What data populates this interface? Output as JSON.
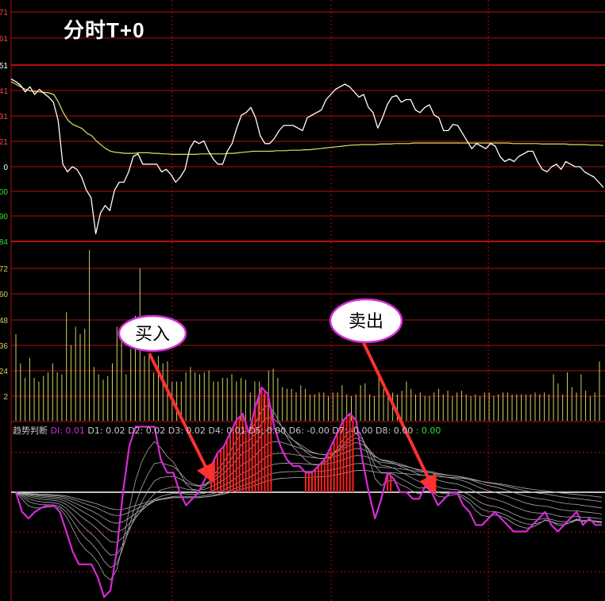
{
  "title": "分时T+0",
  "legend": {
    "name": "趋势判断",
    "items": [
      {
        "label": "DI: 0.01",
        "kind": "hl"
      },
      {
        "label": "D1: 0.02",
        "kind": ""
      },
      {
        "label": "D2: 0.02",
        "kind": ""
      },
      {
        "label": "D3: 0.02",
        "kind": ""
      },
      {
        "label": "D4: 0.01",
        "kind": ""
      },
      {
        "label": "D5: 0.00",
        "kind": ""
      },
      {
        "label": "D6: -0.00",
        "kind": ""
      },
      {
        "label": "D7: -0.00",
        "kind": ""
      },
      {
        "label": "D8: 0.00",
        "kind": ""
      },
      {
        "label": ": 0.00",
        "kind": "gr"
      }
    ]
  },
  "annotations": {
    "buy": "买入",
    "sell": "卖出"
  },
  "colors": {
    "background": "#000000",
    "grid": "#b01010",
    "price": "#ffffff",
    "average": "#e0e060",
    "volume": "#d0d060",
    "di": "#d52bd6",
    "d_lines": "#aaaaaa",
    "bars": "#ff2020",
    "arrow": "#ff3030",
    "ellipse": "#d52bd6"
  },
  "chart_data": [
    {
      "type": "line",
      "panel": "price",
      "y_tick_labels": [
        "71",
        "61",
        "51",
        "41",
        "31",
        "21",
        "0",
        "00",
        "90",
        "84"
      ],
      "series": [
        {
          "values": [
            1.7,
            1.65,
            1.58,
            1.45,
            1.55,
            1.4,
            1.5,
            1.42,
            1.35,
            1.25,
            0.9,
            0.05,
            -0.1,
            0.0,
            -0.05,
            -0.2,
            -0.45,
            -0.6,
            -1.3,
            -0.9,
            -0.75,
            -0.85,
            -0.45,
            -0.3,
            -0.3,
            -0.1,
            0.2,
            0.25,
            0.05,
            0.05,
            0.05,
            0.05,
            -0.1,
            -0.05,
            -0.15,
            -0.3,
            -0.2,
            -0.05,
            0.35,
            0.5,
            0.45,
            0.5,
            0.3,
            0.15,
            0.05,
            0.05,
            0.3,
            0.45,
            0.75,
            1.0,
            1.05,
            1.15,
            0.95,
            0.6,
            0.45,
            0.45,
            0.55,
            0.7,
            0.8,
            0.8,
            0.8,
            0.75,
            0.7,
            0.95,
            1.0,
            1.05,
            1.1,
            1.3,
            1.4,
            1.5,
            1.55,
            1.6,
            1.55,
            1.45,
            1.35,
            1.4,
            1.15,
            1.05,
            0.75,
            0.95,
            1.2,
            1.35,
            1.38,
            1.25,
            1.3,
            1.3,
            1.1,
            1.05,
            1.15,
            1.2,
            1.0,
            0.95,
            0.7,
            0.7,
            0.82,
            0.8,
            0.65,
            0.5,
            0.35,
            0.45,
            0.4,
            0.35,
            0.45,
            0.4,
            0.2,
            0.1,
            0.15,
            0.1,
            0.2,
            0.25,
            0.3,
            0.3,
            0.1,
            -0.05,
            -0.1,
            0.0,
            0.05,
            -0.05,
            0.1,
            0.05,
            0.0,
            0.0,
            -0.1,
            -0.15,
            -0.2,
            -0.3,
            -0.4
          ]
        },
        {
          "values": [
            1.65,
            1.6,
            1.55,
            1.5,
            1.47,
            1.46,
            1.45,
            1.44,
            1.43,
            1.4,
            1.25,
            1.05,
            0.9,
            0.82,
            0.78,
            0.74,
            0.65,
            0.6,
            0.5,
            0.42,
            0.35,
            0.3,
            0.28,
            0.27,
            0.26,
            0.26,
            0.26,
            0.27,
            0.27,
            0.27,
            0.26,
            0.26,
            0.25,
            0.25,
            0.24,
            0.24,
            0.24,
            0.24,
            0.24,
            0.24,
            0.25,
            0.25,
            0.25,
            0.25,
            0.25,
            0.25,
            0.26,
            0.26,
            0.27,
            0.28,
            0.29,
            0.3,
            0.3,
            0.3,
            0.3,
            0.3,
            0.31,
            0.31,
            0.31,
            0.32,
            0.32,
            0.32,
            0.33,
            0.33,
            0.34,
            0.35,
            0.36,
            0.37,
            0.38,
            0.39,
            0.4,
            0.41,
            0.42,
            0.42,
            0.43,
            0.43,
            0.43,
            0.43,
            0.44,
            0.44,
            0.44,
            0.45,
            0.45,
            0.45,
            0.45,
            0.46,
            0.46,
            0.46,
            0.46,
            0.46,
            0.46,
            0.46,
            0.46,
            0.46,
            0.46,
            0.46,
            0.46,
            0.46,
            0.46,
            0.46,
            0.46,
            0.46,
            0.46,
            0.46,
            0.46,
            0.46,
            0.45,
            0.45,
            0.45,
            0.45,
            0.45,
            0.45,
            0.44,
            0.44,
            0.44,
            0.44,
            0.44,
            0.44,
            0.43,
            0.43,
            0.43,
            0.43,
            0.42,
            0.42,
            0.42,
            0.41
          ]
        }
      ]
    },
    {
      "type": "bar",
      "panel": "volume",
      "y_tick_labels": [
        "72",
        "60",
        "48",
        "36",
        "24",
        "2"
      ],
      "values": [
        36,
        20,
        12,
        23,
        12,
        10,
        13,
        15,
        20,
        15,
        14,
        48,
        30,
        40,
        36,
        39,
        82,
        18,
        14,
        11,
        13,
        20,
        40,
        33,
        14,
        28,
        46,
        72,
        24,
        25,
        15,
        24,
        20,
        21,
        10,
        10,
        10,
        15,
        18,
        15,
        14,
        15,
        16,
        10,
        10,
        12,
        12,
        14,
        10,
        12,
        11,
        4,
        10,
        10,
        3,
        16,
        17,
        12,
        7,
        6,
        6,
        4,
        8,
        6,
        3,
        3,
        4,
        4,
        2,
        4,
        4,
        8,
        3,
        2,
        3,
        8,
        9,
        3,
        2,
        13,
        6,
        5,
        4,
        3,
        5,
        10,
        6,
        3,
        4,
        2,
        2,
        4,
        6,
        3,
        5,
        2,
        4,
        5,
        3,
        2,
        3,
        2,
        4,
        4,
        2,
        3,
        4,
        4,
        3,
        3,
        3,
        3,
        3,
        4,
        3,
        4,
        3,
        14,
        9,
        3,
        15,
        7,
        4,
        14,
        5,
        2,
        4,
        21
      ]
    },
    {
      "type": "line",
      "panel": "indicator",
      "series": [
        {
          "name": "DI",
          "values": [
            0.0,
            -0.15,
            -0.2,
            -0.15,
            -0.12,
            -0.1,
            -0.1,
            -0.15,
            -0.3,
            -0.45,
            -0.55,
            -0.55,
            -0.55,
            -0.65,
            -0.8,
            -0.75,
            -0.45,
            0.0,
            0.35,
            0.5,
            0.5,
            0.5,
            0.5,
            0.25,
            0.15,
            0.15,
            0.0,
            -0.1,
            -0.05,
            0.0,
            0.1,
            0.2,
            0.3,
            0.35,
            0.45,
            0.55,
            0.6,
            0.45,
            0.65,
            0.8,
            0.75,
            0.5,
            0.35,
            0.25,
            0.2,
            0.2,
            0.15,
            0.15,
            0.2,
            0.25,
            0.35,
            0.45,
            0.55,
            0.6,
            0.55,
            0.25,
            0.0,
            -0.2,
            -0.05,
            0.15,
            0.1,
            0.0,
            0.0,
            -0.05,
            -0.05,
            0.05,
            0.0,
            -0.1,
            -0.05,
            0.0,
            0.0,
            -0.1,
            -0.15,
            -0.25,
            -0.25,
            -0.2,
            -0.15,
            -0.2,
            -0.25,
            -0.3,
            -0.3,
            -0.3,
            -0.25,
            -0.2,
            -0.15,
            -0.25,
            -0.3,
            -0.25,
            -0.2,
            -0.15,
            -0.25,
            -0.2,
            -0.25,
            -0.25
          ]
        }
      ]
    }
  ]
}
